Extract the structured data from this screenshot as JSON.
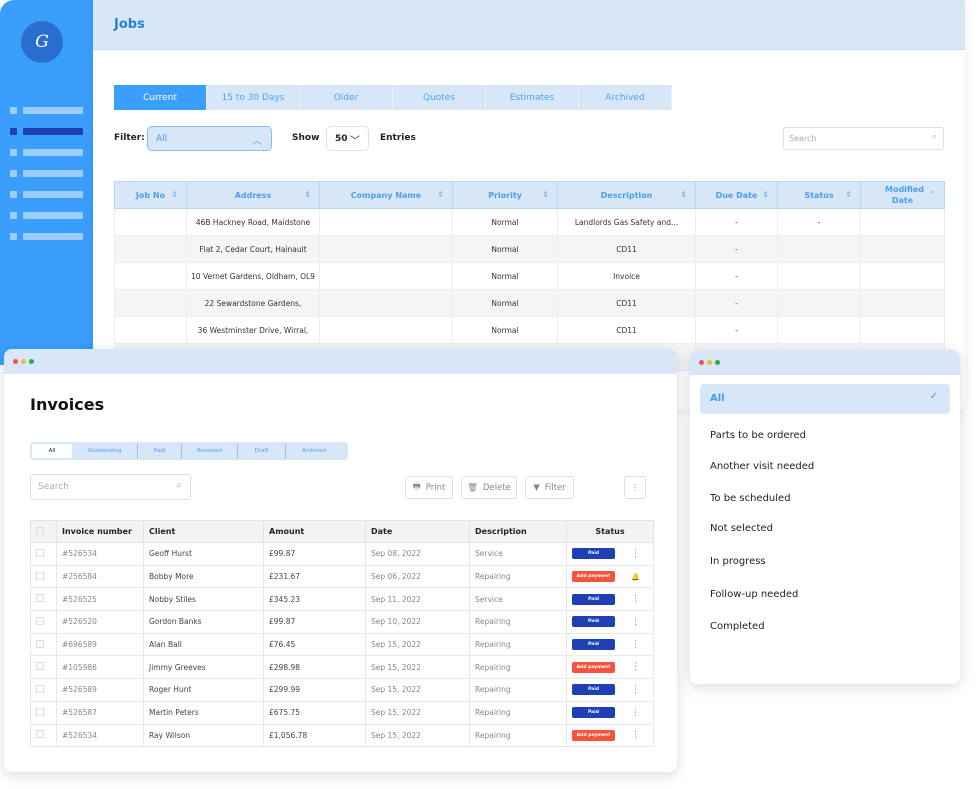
{
  "sidebar": {
    "logo_text": "G",
    "items": [
      {
        "active": false
      },
      {
        "active": true
      },
      {
        "active": false
      },
      {
        "active": false
      },
      {
        "active": false
      },
      {
        "active": false
      },
      {
        "active": false
      }
    ]
  },
  "jobs": {
    "title": "Jobs",
    "tabs": [
      "Current",
      "15 to 30 Days",
      "Older",
      "Quotes",
      "Estimates",
      "Archived"
    ],
    "active_tab": "Current",
    "filter_label": "Filter:",
    "filter_value": "All",
    "show_label": "Show",
    "show_value": "50",
    "entries_label": "Entries",
    "search_placeholder": "Search",
    "columns": [
      "Job No",
      "Address",
      "Company Name",
      "Priority",
      "Description",
      "Due Date",
      "Status",
      "Modified Date"
    ],
    "rows": [
      [
        "",
        "46B Hackney Road, Maidstone",
        "",
        "Normal",
        "Landlords Gas Safety and...",
        "-",
        "-",
        ""
      ],
      [
        "",
        "Flat 2, Cedar Court, Hainault",
        "",
        "Normal",
        "CD11",
        "-",
        "",
        ""
      ],
      [
        "",
        "10 Vernet Gardens, Oldham, OL9",
        "",
        "Normal",
        "Invoice",
        "-",
        "",
        ""
      ],
      [
        "",
        "22 Sewardstone Gardens,",
        "",
        "Normal",
        "CD11",
        "-",
        "",
        ""
      ],
      [
        "",
        "36 Westminster Drive, Wirral,",
        "",
        "Normal",
        "CD11",
        "-",
        "",
        ""
      ]
    ]
  },
  "invoices": {
    "title": "Invoices",
    "tabs": [
      "All",
      "Outstanding",
      "Paid",
      "Received",
      "Draft",
      "Archived"
    ],
    "active_tab": "All",
    "search_placeholder": "Search",
    "buttons": {
      "print": "Print",
      "delete": "Delete",
      "filter": "Filter"
    },
    "columns": [
      "Invoice number",
      "Client",
      "Amount",
      "Date",
      "Description",
      "Status"
    ],
    "rows": [
      {
        "number": "#526534",
        "client": "Geoff Hurst",
        "amount": "£99.87",
        "date": "Sep 08, 2022",
        "description": "Service",
        "status": "Paid",
        "action": "more"
      },
      {
        "number": "#256584",
        "client": "Bobby More",
        "amount": "£231.67",
        "date": "Sep 06, 2022",
        "description": "Repairing",
        "status": "Add payment",
        "action": "bell"
      },
      {
        "number": "#526525",
        "client": "Nobby Stiles",
        "amount": "£345.23",
        "date": "Sep 11, 2022",
        "description": "Service",
        "status": "Paid",
        "action": "more"
      },
      {
        "number": "#526520",
        "client": "Gordon Banks",
        "amount": "£99.87",
        "date": "Sep 10, 2022",
        "description": "Repairing",
        "status": "Paid",
        "action": "more"
      },
      {
        "number": "#696589",
        "client": "Alan Ball",
        "amount": "£76.45",
        "date": "Sep 15, 2022",
        "description": "Repairing",
        "status": "Paid",
        "action": "more"
      },
      {
        "number": "#105986",
        "client": "Jimmy Greeves",
        "amount": "£298.98",
        "date": "Sep 15, 2022",
        "description": "Repairing",
        "status": "Add payment",
        "action": "more"
      },
      {
        "number": "#526589",
        "client": "Roger Hunt",
        "amount": "£299.99",
        "date": "Sep 15, 2022",
        "description": "Repairing",
        "status": "Paid",
        "action": "more"
      },
      {
        "number": "#526587",
        "client": "Martin Peters",
        "amount": "£675.75",
        "date": "Sep 15, 2022",
        "description": "Repairing",
        "status": "Paid",
        "action": "more"
      },
      {
        "number": "#526534",
        "client": "Ray Wilson",
        "amount": "£1,056.78",
        "date": "Sep 15, 2022",
        "description": "Repairing",
        "status": "Add payment",
        "action": "more"
      }
    ]
  },
  "status_dropdown": {
    "selected": "All",
    "options": [
      "All",
      "Parts to be ordered",
      "Another visit needed",
      "To be scheduled",
      "Not selected",
      "In progress",
      "Follow-up needed",
      "Completed"
    ]
  },
  "colors": {
    "primary": "#3a9efd",
    "light": "#d7e7f8",
    "paid": "#1f3fb5",
    "add_payment": "#f5533d",
    "normal": "#3aa35c"
  }
}
